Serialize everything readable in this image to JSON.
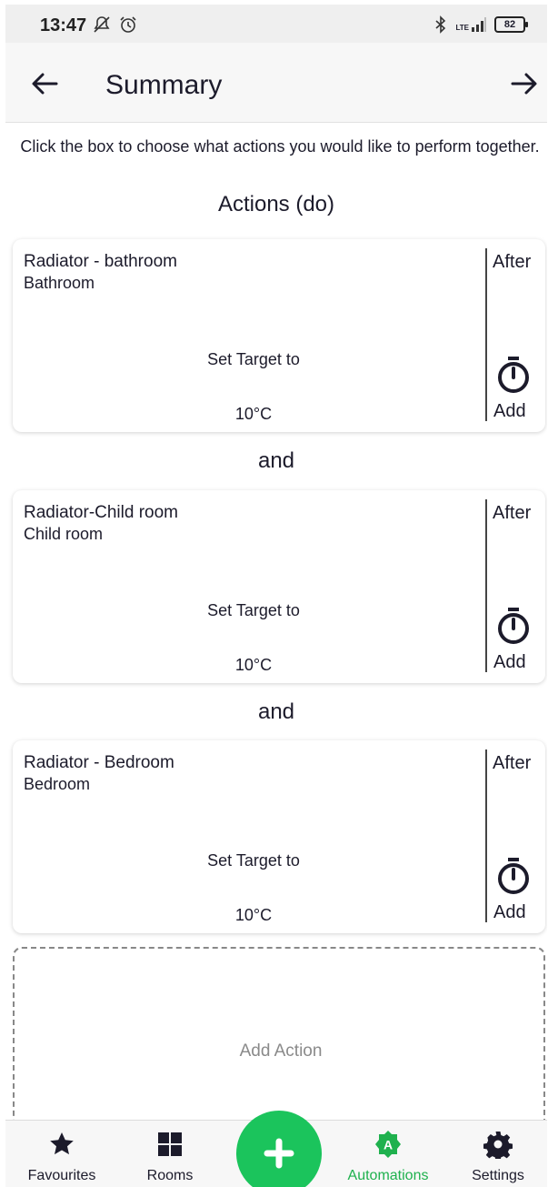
{
  "status_bar": {
    "time": "13:47",
    "icons": [
      "notifications-off-icon",
      "alarm-icon",
      "bluetooth-icon",
      "signal-icon"
    ],
    "network": "LTE",
    "battery": "82"
  },
  "header": {
    "title": "Summary",
    "back_icon": "arrow-left-icon",
    "forward_icon": "arrow-right-icon"
  },
  "instructions": "Click the box to choose what actions you would like to perform together.",
  "section_title": "Actions (do)",
  "actions": [
    {
      "device": "Radiator - bathroom",
      "room": "Bathroom",
      "action": "Set Target to",
      "value": "10°C",
      "after": "After",
      "add": "Add"
    },
    {
      "device": "Radiator-Child room",
      "room": "Child room",
      "action": "Set Target to",
      "value": "10°C",
      "after": "After",
      "add": "Add"
    },
    {
      "device": "Radiator - Bedroom",
      "room": "Bedroom",
      "action": "Set Target to",
      "value": "10°C",
      "after": "After",
      "add": "Add"
    }
  ],
  "connectors": [
    "and",
    "and"
  ],
  "add_action": "Add Action",
  "bottom_nav": {
    "items": [
      {
        "label": "Favourites",
        "icon": "star-icon",
        "active": false
      },
      {
        "label": "Rooms",
        "icon": "grid-icon",
        "active": false
      },
      {
        "label": "Automations",
        "icon": "automations-icon",
        "active": true
      },
      {
        "label": "Settings",
        "icon": "gear-icon",
        "active": false
      }
    ],
    "fab_icon": "plus-icon"
  },
  "colors": {
    "accent": "#1bc45c",
    "active_nav": "#1fb14e",
    "text": "#1c1b2b",
    "muted": "#8a8a8a"
  }
}
